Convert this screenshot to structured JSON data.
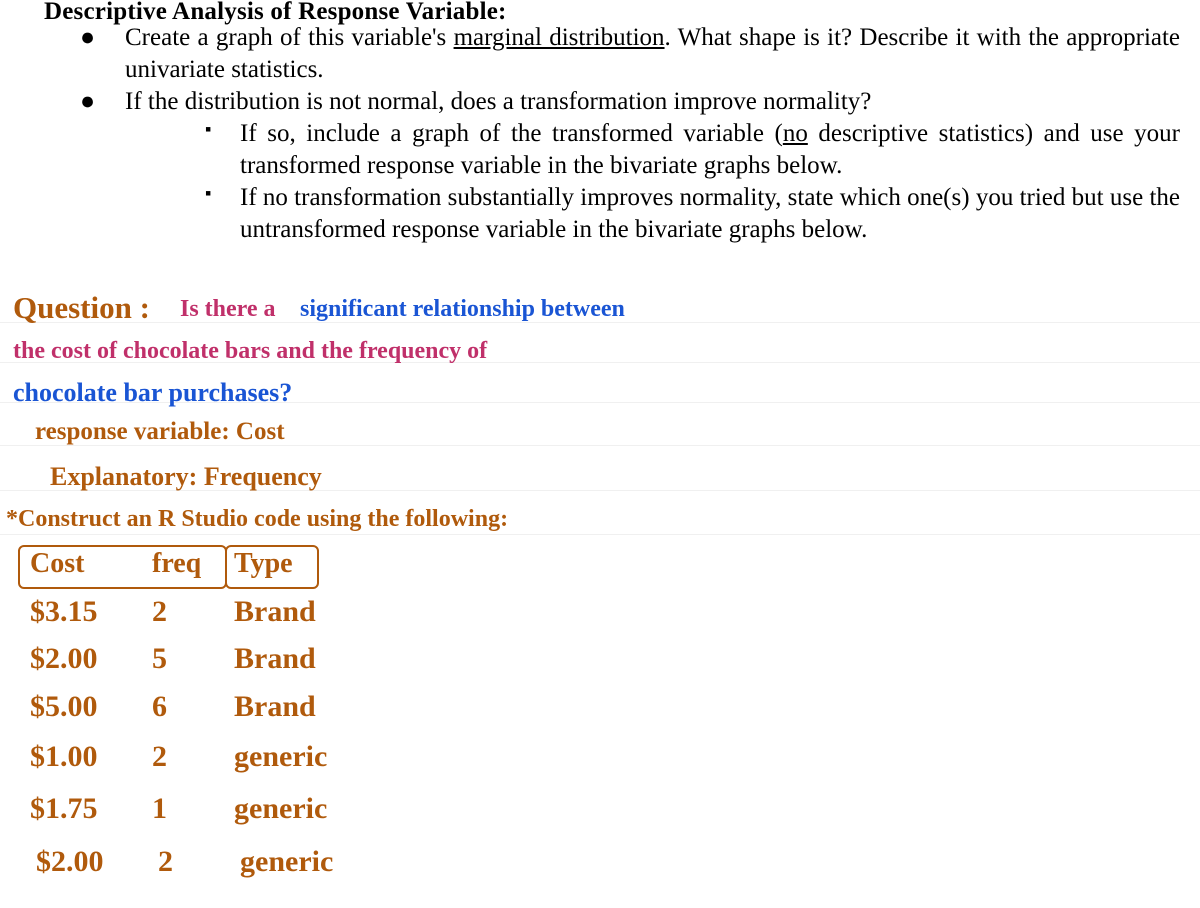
{
  "heading": "Descriptive Analysis of Response Variable:",
  "bullets": {
    "b1_part1": "Create a graph of this variable's ",
    "b1_underlined": "marginal distribution",
    "b1_part2": ".  What shape is it? Describe it with the appropriate univariate statistics.",
    "b2": "If the distribution is not normal, does a transformation improve normality?",
    "s1_part1": "If so, include a graph of the transformed variable (",
    "s1_underlined": "no",
    "s1_part2": " descriptive statistics) and use your transformed response variable in the bivariate graphs below.",
    "s2": "If no transformation substantially improves normality, state which one(s) you tried but use the untransformed response variable in the bivariate graphs below."
  },
  "handwriting": {
    "q_prefix": "Question : ",
    "q_text_1": "Is there a",
    "q_text_2": "significant relationship between",
    "line2": "the cost of chocolate bars and the frequency of",
    "line3": "chocolate bar purchases?",
    "resp": "response variable: Cost",
    "expl": "Explanatory: Frequency",
    "construct": "*Construct an R Studio code using the following:"
  },
  "table": {
    "headers": {
      "c1": "Cost",
      "c2": "freq",
      "c3": "Type"
    },
    "rows": [
      {
        "c1": "$3.15",
        "c2": "2",
        "c3": "Brand"
      },
      {
        "c1": "$2.00",
        "c2": "5",
        "c3": "Brand"
      },
      {
        "c1": "$5.00",
        "c2": "6",
        "c3": "Brand"
      },
      {
        "c1": "$1.00",
        "c2": "2",
        "c3": "generic"
      },
      {
        "c1": "$1.75",
        "c2": "1",
        "c3": "generic"
      },
      {
        "c1": "$2.00",
        "c2": "2",
        "c3": "generic"
      }
    ]
  }
}
